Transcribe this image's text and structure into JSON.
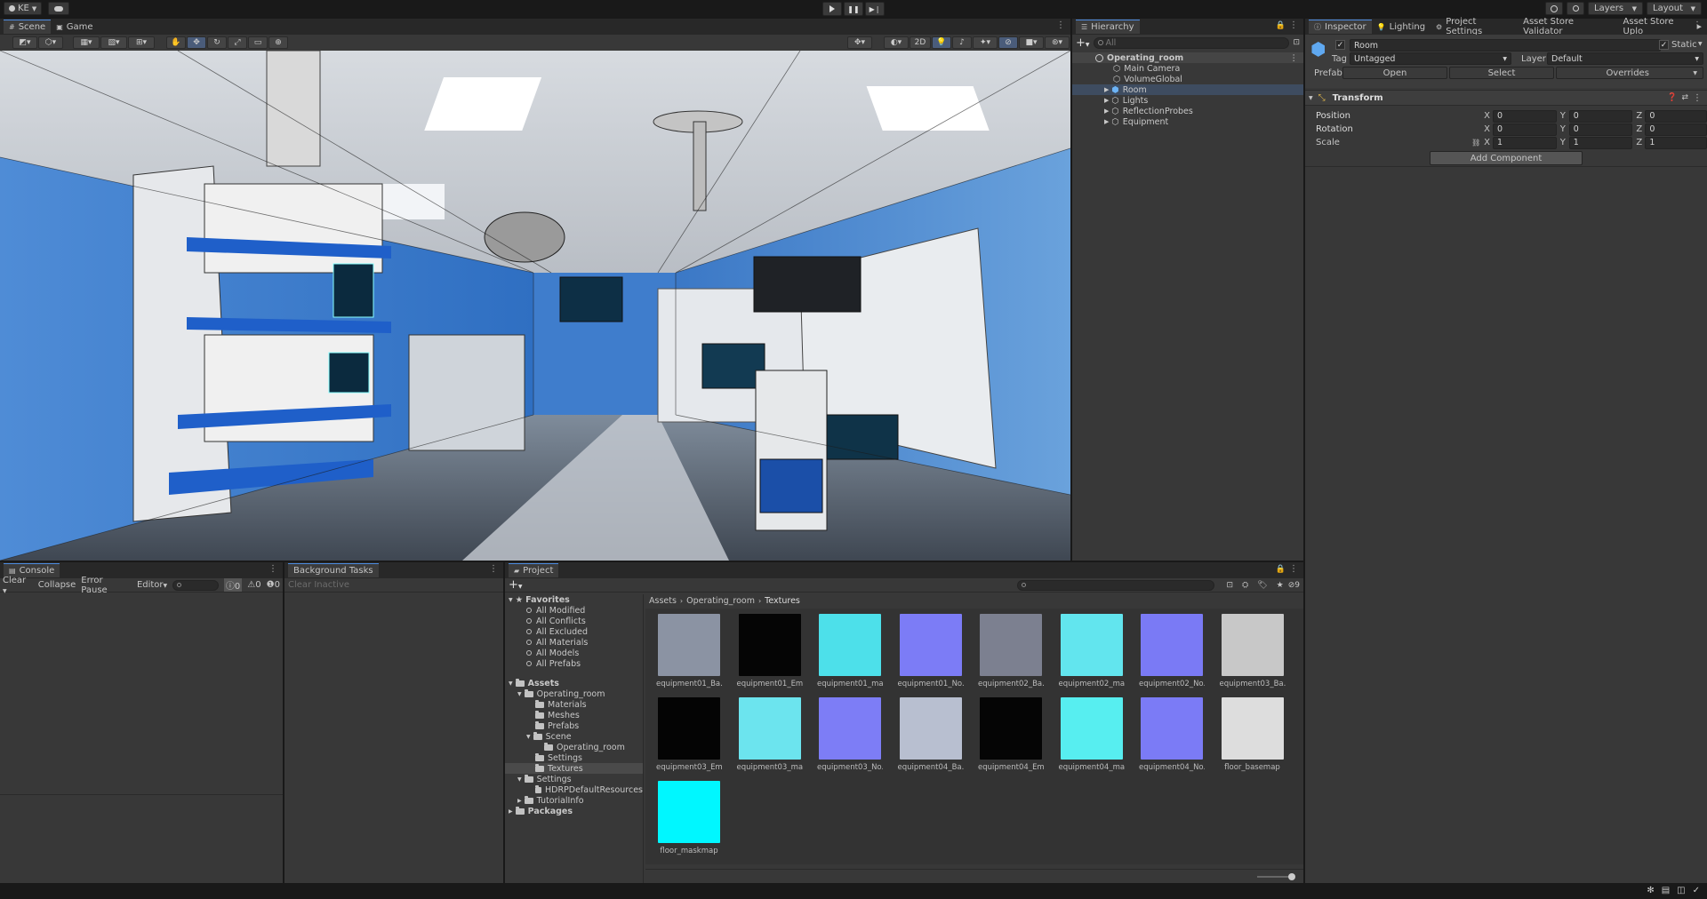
{
  "topbar": {
    "account": "KE",
    "layers": "Layers",
    "layout": "Layout"
  },
  "scene_tabs": {
    "scene": "Scene",
    "game": "Game",
    "toggle_2d": "2D"
  },
  "hierarchy": {
    "title": "Hierarchy",
    "search_placeholder": "All",
    "root": "Operating_room",
    "items": [
      "Main Camera",
      "VolumeGlobal",
      "Room",
      "Lights",
      "ReflectionProbes",
      "Equipment"
    ]
  },
  "inspector": {
    "tabs": [
      "Inspector",
      "Lighting",
      "Project Settings",
      "Asset Store Validator",
      "Asset Store Uplo"
    ],
    "object_name": "Room",
    "static_label": "Static",
    "tag_label": "Tag",
    "tag_value": "Untagged",
    "layer_label": "Layer",
    "layer_value": "Default",
    "prefab_label": "Prefab",
    "prefab_open": "Open",
    "prefab_select": "Select",
    "prefab_overrides": "Overrides",
    "component": "Transform",
    "position_label": "Position",
    "rotation_label": "Rotation",
    "scale_label": "Scale",
    "axis": {
      "x": "X",
      "y": "Y",
      "z": "Z"
    },
    "position": [
      "0",
      "0",
      "0"
    ],
    "rotation": [
      "0",
      "0",
      "0"
    ],
    "scale": [
      "1",
      "1",
      "1"
    ],
    "add_component": "Add Component"
  },
  "console": {
    "title": "Console",
    "clear": "Clear",
    "collapse": "Collapse",
    "error_pause": "Error Pause",
    "editor": "Editor",
    "count_logs": "0",
    "count_warnings": "0",
    "count_errors": "0"
  },
  "background_tasks": {
    "title": "Background Tasks",
    "clear_inactive": "Clear Inactive"
  },
  "project": {
    "title": "Project",
    "hidden_count": "9",
    "favorites_label": "Favorites",
    "favorites": [
      "All Modified",
      "All Conflicts",
      "All Excluded",
      "All Materials",
      "All Models",
      "All Prefabs"
    ],
    "assets_label": "Assets",
    "operating_room": "Operating_room",
    "materials": "Materials",
    "meshes": "Meshes",
    "prefabs": "Prefabs",
    "scene": "Scene",
    "scene_child": "Operating_room",
    "settings": "Settings",
    "textures": "Textures",
    "settings_root": "Settings",
    "hdrp": "HDRPDefaultResources",
    "tutorial": "TutorialInfo",
    "packages_label": "Packages",
    "breadcrumb": [
      "Assets",
      "Operating_room",
      "Textures"
    ],
    "assets": [
      {
        "name": "equipment01_Ba...",
        "color": "#8b93a3"
      },
      {
        "name": "equipment01_Emi...",
        "color": "#050505"
      },
      {
        "name": "equipment01_ma...",
        "color": "#4de0ea"
      },
      {
        "name": "equipment01_No...",
        "color": "#7c7cf6"
      },
      {
        "name": "equipment02_Ba...",
        "color": "#7c8090"
      },
      {
        "name": "equipment02_ma...",
        "color": "#62e5ee"
      },
      {
        "name": "equipment02_No...",
        "color": "#7a7af5"
      },
      {
        "name": "equipment03_Ba...",
        "color": "#c8c8c8"
      },
      {
        "name": "equipment03_Emi...",
        "color": "#040404"
      },
      {
        "name": "equipment03_ma...",
        "color": "#6ce4ee"
      },
      {
        "name": "equipment03_No...",
        "color": "#7d7df6"
      },
      {
        "name": "equipment04_Ba...",
        "color": "#b8bfd0"
      },
      {
        "name": "equipment04_Emi...",
        "color": "#050505"
      },
      {
        "name": "equipment04_ma...",
        "color": "#57eef0"
      },
      {
        "name": "equipment04_No...",
        "color": "#7b7bf6"
      },
      {
        "name": "floor_basemap",
        "color": "#dddddd"
      },
      {
        "name": "floor_maskmap",
        "color": "#00f7ff"
      }
    ]
  }
}
